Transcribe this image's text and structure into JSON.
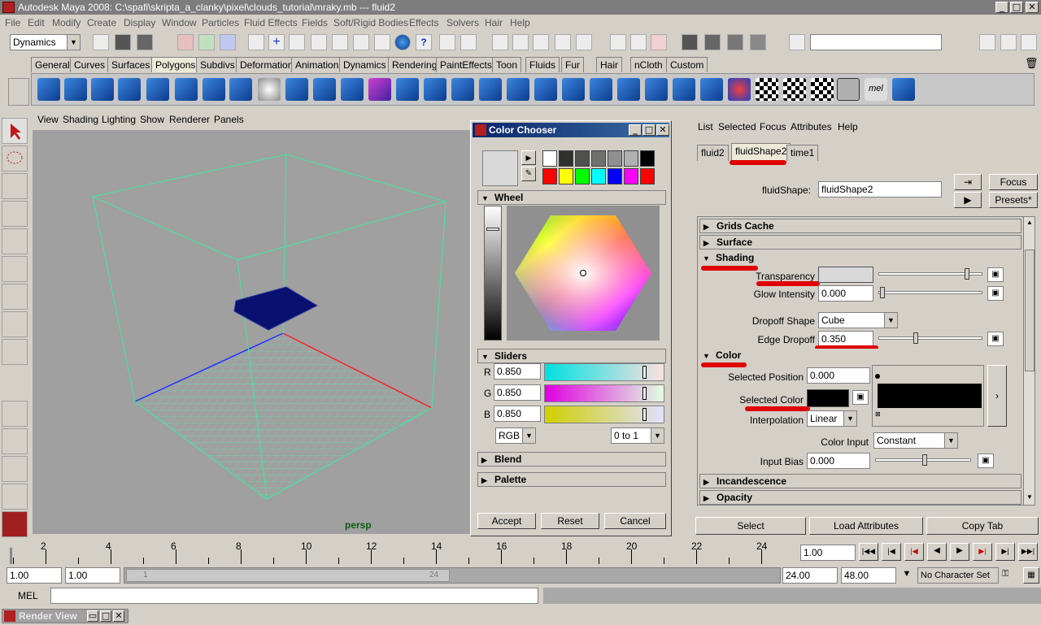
{
  "window": {
    "title": "Autodesk Maya 2008: C:\\spafi\\skripta_a_clanky\\pixel\\clouds_tutorial\\mraky.mb   ---   fluid2",
    "min": "_",
    "max": "□",
    "close": "✕"
  },
  "menubar": [
    "File",
    "Edit",
    "Modify",
    "Create",
    "Display",
    "Window",
    "Particles",
    "Fluid Effects",
    "Fields",
    "Soft/Rigid Bodies",
    "Effects",
    "Solvers",
    "Hair",
    "Help"
  ],
  "toolbar": {
    "menuset": "Dynamics",
    "search_value": ""
  },
  "shelf_tabs": [
    "General",
    "Curves",
    "Surfaces",
    "Polygons",
    "Subdivs",
    "Deformation",
    "Animation",
    "Dynamics",
    "Rendering",
    "PaintEffects",
    "Toon",
    "Fluids",
    "Fur",
    "Hair",
    "nCloth",
    "Custom"
  ],
  "shelf_selected": "Polygons",
  "viewport": {
    "menu": [
      "View",
      "Shading",
      "Lighting",
      "Show",
      "Renderer",
      "Panels"
    ],
    "camera_label": "persp"
  },
  "color_chooser": {
    "title": "Color Chooser",
    "wheel_label": "Wheel",
    "sliders_label": "Sliders",
    "r_label": "R",
    "r_value": "0.850",
    "g_label": "G",
    "g_value": "0.850",
    "b_label": "B",
    "b_value": "0.850",
    "mode": "RGB",
    "range": "0 to 1",
    "blend_label": "Blend",
    "palette_label": "Palette",
    "accept": "Accept",
    "reset": "Reset",
    "cancel": "Cancel",
    "palette_colors": [
      "#ffffff",
      "#303030",
      "#505050",
      "#707070",
      "#909090",
      "#b0b0b0",
      "#000000",
      "#ff0000",
      "#ffff00",
      "#00ff00",
      "#00ffff",
      "#0000ff",
      "#ff00ff",
      "#ff0000"
    ]
  },
  "attribute_editor": {
    "menu": [
      "List",
      "Selected",
      "Focus",
      "Attributes",
      "Help"
    ],
    "tabs": [
      "fluid2",
      "fluidShape2",
      "time1"
    ],
    "selected_tab": "fluidShape2",
    "node_label": "fluidShape:",
    "node_value": "fluidShape2",
    "focus": "Focus",
    "presets": "Presets*",
    "sections": {
      "grids_cache": "Grids Cache",
      "surface": "Surface",
      "shading": "Shading",
      "color": "Color",
      "incandescence": "Incandescence",
      "opacity": "Opacity"
    },
    "transparency_label": "Transparency",
    "transparency_level": 0.85,
    "glow_label": "Glow Intensity",
    "glow_value": "0.000",
    "dropoff_shape_label": "Dropoff Shape",
    "dropoff_shape_value": "Cube",
    "edge_dropoff_label": "Edge Dropoff",
    "edge_dropoff_value": "0.350",
    "selected_position_label": "Selected Position",
    "selected_position_value": "0.000",
    "selected_color_label": "Selected Color",
    "interpolation_label": "Interpolation",
    "interpolation_value": "Linear",
    "color_input_label": "Color Input",
    "color_input_value": "Constant",
    "input_bias_label": "Input Bias",
    "input_bias_value": "0.000",
    "arrow": "›",
    "bottom_buttons": [
      "Select",
      "Load Attributes",
      "Copy Tab"
    ]
  },
  "timeline": {
    "ticks": [
      "2",
      "4",
      "6",
      "8",
      "10",
      "12",
      "14",
      "16",
      "18",
      "20",
      "22",
      "24"
    ],
    "current_frame": "1.00"
  },
  "range": {
    "start": "1.00",
    "start2": "1.00",
    "slider_start": "1",
    "slider_end": "24",
    "end": "24.00",
    "end2": "48.00",
    "character": "No Character Set"
  },
  "cmdline": {
    "label": "MEL",
    "value": ""
  },
  "taskbar": {
    "item": "Render View"
  }
}
